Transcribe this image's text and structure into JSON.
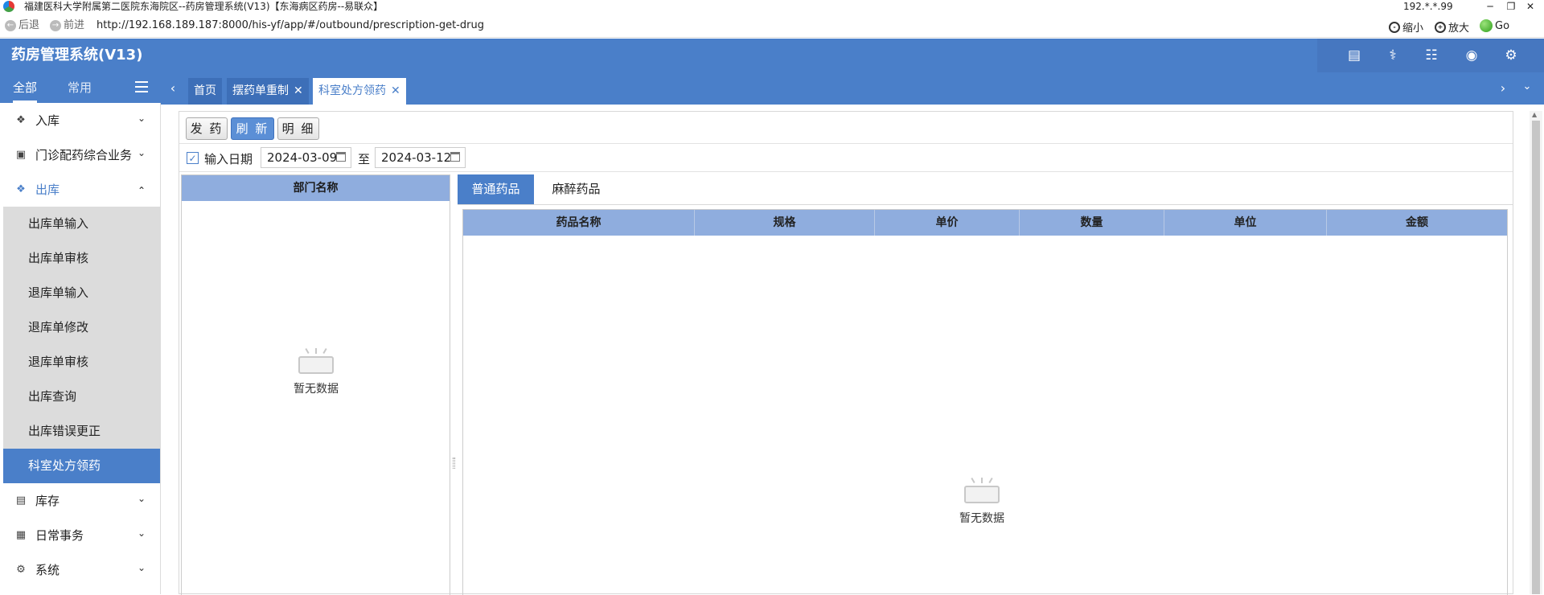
{
  "window": {
    "title": "福建医科大学附属第二医院东海院区--药房管理系统(V13)【东海病区药房--易联众】",
    "ip": "192.*.*.99",
    "controls": [
      "minimize",
      "restore",
      "close"
    ]
  },
  "browser": {
    "back_label": "后退",
    "forward_label": "前进",
    "url": "http://192.168.189.187:8000/his-yf/app/#/outbound/prescription-get-drug",
    "zoom_out_label": "缩小",
    "zoom_in_label": "放大",
    "go_label": "Go"
  },
  "app": {
    "title": "药房管理系统(V13)",
    "header_icons": [
      "card-icon",
      "medicine-icon",
      "receipt-icon",
      "eye-icon",
      "gear-icon"
    ]
  },
  "sidebar": {
    "tabs": [
      "全部",
      "常用"
    ],
    "items": [
      {
        "label": "入库",
        "icon": "box-icon",
        "chevron": "down"
      },
      {
        "label": "门诊配药综合业务",
        "icon": "lock-icon",
        "chevron": "down"
      },
      {
        "label": "出库",
        "icon": "box-icon",
        "chevron": "up"
      },
      {
        "label": "库存",
        "icon": "inventory-icon",
        "chevron": "down"
      },
      {
        "label": "日常事务",
        "icon": "calendar-icon",
        "chevron": "down"
      },
      {
        "label": "系统",
        "icon": "gear-icon",
        "chevron": "down"
      }
    ],
    "subitems": [
      "出库单输入",
      "出库单审核",
      "退库单输入",
      "退库单修改",
      "退库单审核",
      "出库查询",
      "出库错误更正",
      "科室处方领药"
    ],
    "active_subitem": "科室处方领药"
  },
  "tabs": [
    {
      "label": "首页",
      "closable": false
    },
    {
      "label": "摆药单重制",
      "closable": true
    },
    {
      "label": "科室处方领药",
      "closable": true,
      "active": true
    }
  ],
  "toolbar": {
    "dispense_label": "发 药",
    "refresh_label": "刷 新",
    "detail_label": "明 细"
  },
  "filter": {
    "checkbox_checked": true,
    "date_label": "输入日期",
    "start_date": "2024-03-09",
    "to_label": "至",
    "end_date": "2024-03-12"
  },
  "left_panel": {
    "header": "部门名称",
    "empty_text": "暂无数据"
  },
  "right_panel": {
    "tabs": [
      "普通药品",
      "麻醉药品"
    ],
    "active_tab": "普通药品",
    "columns": [
      "药品名称",
      "规格",
      "单价",
      "数量",
      "单位",
      "金额"
    ],
    "rows": [],
    "empty_text": "暂无数据"
  },
  "colors": {
    "primary": "#4a7fc9",
    "header_blue": "#8fadde",
    "submenu_bg": "#dcdcdc"
  }
}
